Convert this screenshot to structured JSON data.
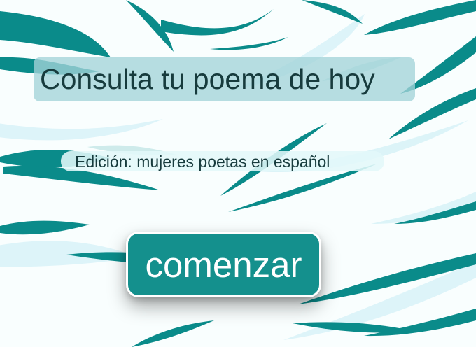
{
  "page": {
    "title": "Consulta tu poema de hoy",
    "subtitle": "Edición: mujeres poetas en español"
  },
  "actions": {
    "start_label": "comenzar"
  },
  "colors": {
    "background": "#f9fefe",
    "accent": "#14908d",
    "brush_light": "#d9f3f8",
    "title_bg": "#a3d3d8",
    "text": "#173b3d"
  },
  "decorations": {
    "background_art": "teal brush-stroke leaves"
  }
}
